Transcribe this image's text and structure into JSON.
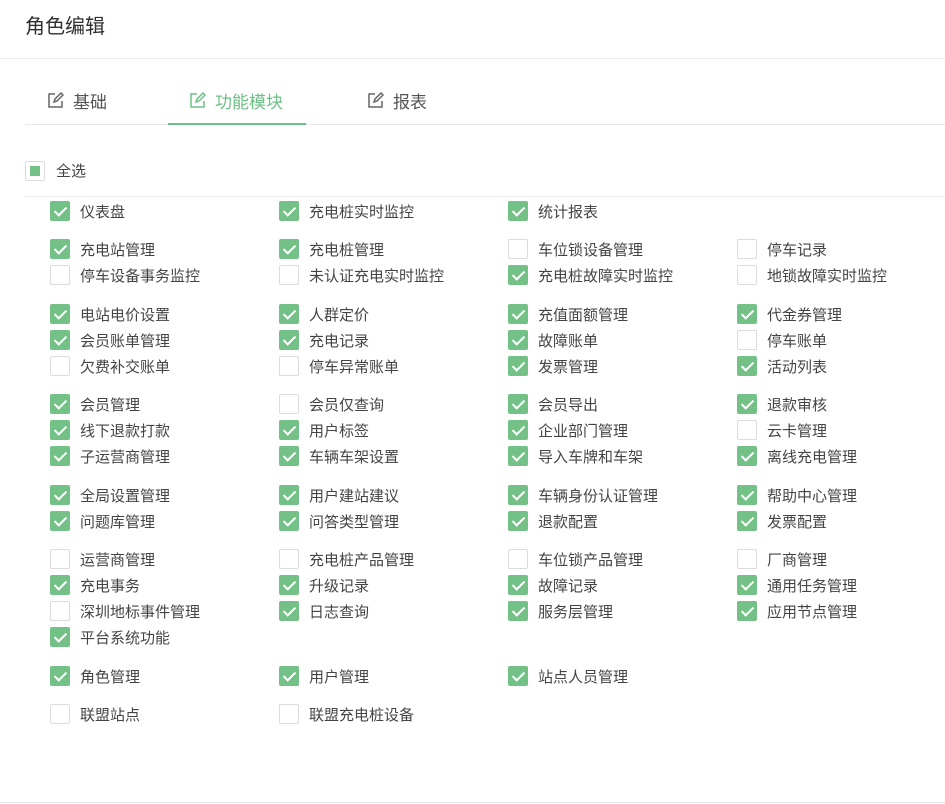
{
  "header": {
    "title": "角色编辑"
  },
  "tabs": [
    {
      "label": "基础",
      "icon": "edit-icon",
      "active": false
    },
    {
      "label": "功能模块",
      "icon": "edit-icon",
      "active": true
    },
    {
      "label": "报表",
      "icon": "edit-icon",
      "active": false
    }
  ],
  "select_all": {
    "label": "全选",
    "state": "partial"
  },
  "colors": {
    "accent": "#6cc085",
    "checkbox": "#73c186"
  },
  "groups": [
    {
      "rows": [
        [
          {
            "label": "仪表盘",
            "checked": true
          },
          {
            "label": "充电桩实时监控",
            "checked": true
          },
          {
            "label": "统计报表",
            "checked": true
          }
        ]
      ]
    },
    {
      "rows": [
        [
          {
            "label": "充电站管理",
            "checked": true
          },
          {
            "label": "充电桩管理",
            "checked": true
          },
          {
            "label": "车位锁设备管理",
            "checked": false
          },
          {
            "label": "停车记录",
            "checked": false
          }
        ],
        [
          {
            "label": "停车设备事务监控",
            "checked": false
          },
          {
            "label": "未认证充电实时监控",
            "checked": false
          },
          {
            "label": "充电桩故障实时监控",
            "checked": true
          },
          {
            "label": "地锁故障实时监控",
            "checked": false
          }
        ]
      ]
    },
    {
      "rows": [
        [
          {
            "label": "电站电价设置",
            "checked": true
          },
          {
            "label": "人群定价",
            "checked": true
          },
          {
            "label": "充值面额管理",
            "checked": true
          },
          {
            "label": "代金券管理",
            "checked": true
          }
        ],
        [
          {
            "label": "会员账单管理",
            "checked": true
          },
          {
            "label": "充电记录",
            "checked": true
          },
          {
            "label": "故障账单",
            "checked": true
          },
          {
            "label": "停车账单",
            "checked": false
          }
        ],
        [
          {
            "label": "欠费补交账单",
            "checked": false
          },
          {
            "label": "停车异常账单",
            "checked": false
          },
          {
            "label": "发票管理",
            "checked": true
          },
          {
            "label": "活动列表",
            "checked": true
          }
        ]
      ]
    },
    {
      "rows": [
        [
          {
            "label": "会员管理",
            "checked": true
          },
          {
            "label": "会员仅查询",
            "checked": false
          },
          {
            "label": "会员导出",
            "checked": true
          },
          {
            "label": "退款审核",
            "checked": true
          }
        ],
        [
          {
            "label": "线下退款打款",
            "checked": true
          },
          {
            "label": "用户标签",
            "checked": true
          },
          {
            "label": "企业部门管理",
            "checked": true
          },
          {
            "label": "云卡管理",
            "checked": false
          }
        ],
        [
          {
            "label": "子运营商管理",
            "checked": true
          },
          {
            "label": "车辆车架设置",
            "checked": true
          },
          {
            "label": "导入车牌和车架",
            "checked": true
          },
          {
            "label": "离线充电管理",
            "checked": true
          }
        ]
      ]
    },
    {
      "rows": [
        [
          {
            "label": "全局设置管理",
            "checked": true
          },
          {
            "label": "用户建站建议",
            "checked": true
          },
          {
            "label": "车辆身份认证管理",
            "checked": true
          },
          {
            "label": "帮助中心管理",
            "checked": true
          }
        ],
        [
          {
            "label": "问题库管理",
            "checked": true
          },
          {
            "label": "问答类型管理",
            "checked": true
          },
          {
            "label": "退款配置",
            "checked": true
          },
          {
            "label": "发票配置",
            "checked": true
          }
        ]
      ]
    },
    {
      "rows": [
        [
          {
            "label": "运营商管理",
            "checked": false
          },
          {
            "label": "充电桩产品管理",
            "checked": false
          },
          {
            "label": "车位锁产品管理",
            "checked": false
          },
          {
            "label": "厂商管理",
            "checked": false
          }
        ],
        [
          {
            "label": "充电事务",
            "checked": true
          },
          {
            "label": "升级记录",
            "checked": true
          },
          {
            "label": "故障记录",
            "checked": true
          },
          {
            "label": "通用任务管理",
            "checked": true
          }
        ],
        [
          {
            "label": "深圳地标事件管理",
            "checked": false
          },
          {
            "label": "日志查询",
            "checked": true
          },
          {
            "label": "服务层管理",
            "checked": true
          },
          {
            "label": "应用节点管理",
            "checked": true
          }
        ],
        [
          {
            "label": "平台系统功能",
            "checked": true
          }
        ]
      ]
    },
    {
      "rows": [
        [
          {
            "label": "角色管理",
            "checked": true
          },
          {
            "label": "用户管理",
            "checked": true
          },
          {
            "label": "站点人员管理",
            "checked": true
          }
        ]
      ]
    },
    {
      "rows": [
        [
          {
            "label": "联盟站点",
            "checked": false
          },
          {
            "label": "联盟充电桩设备",
            "checked": false
          }
        ]
      ]
    }
  ]
}
